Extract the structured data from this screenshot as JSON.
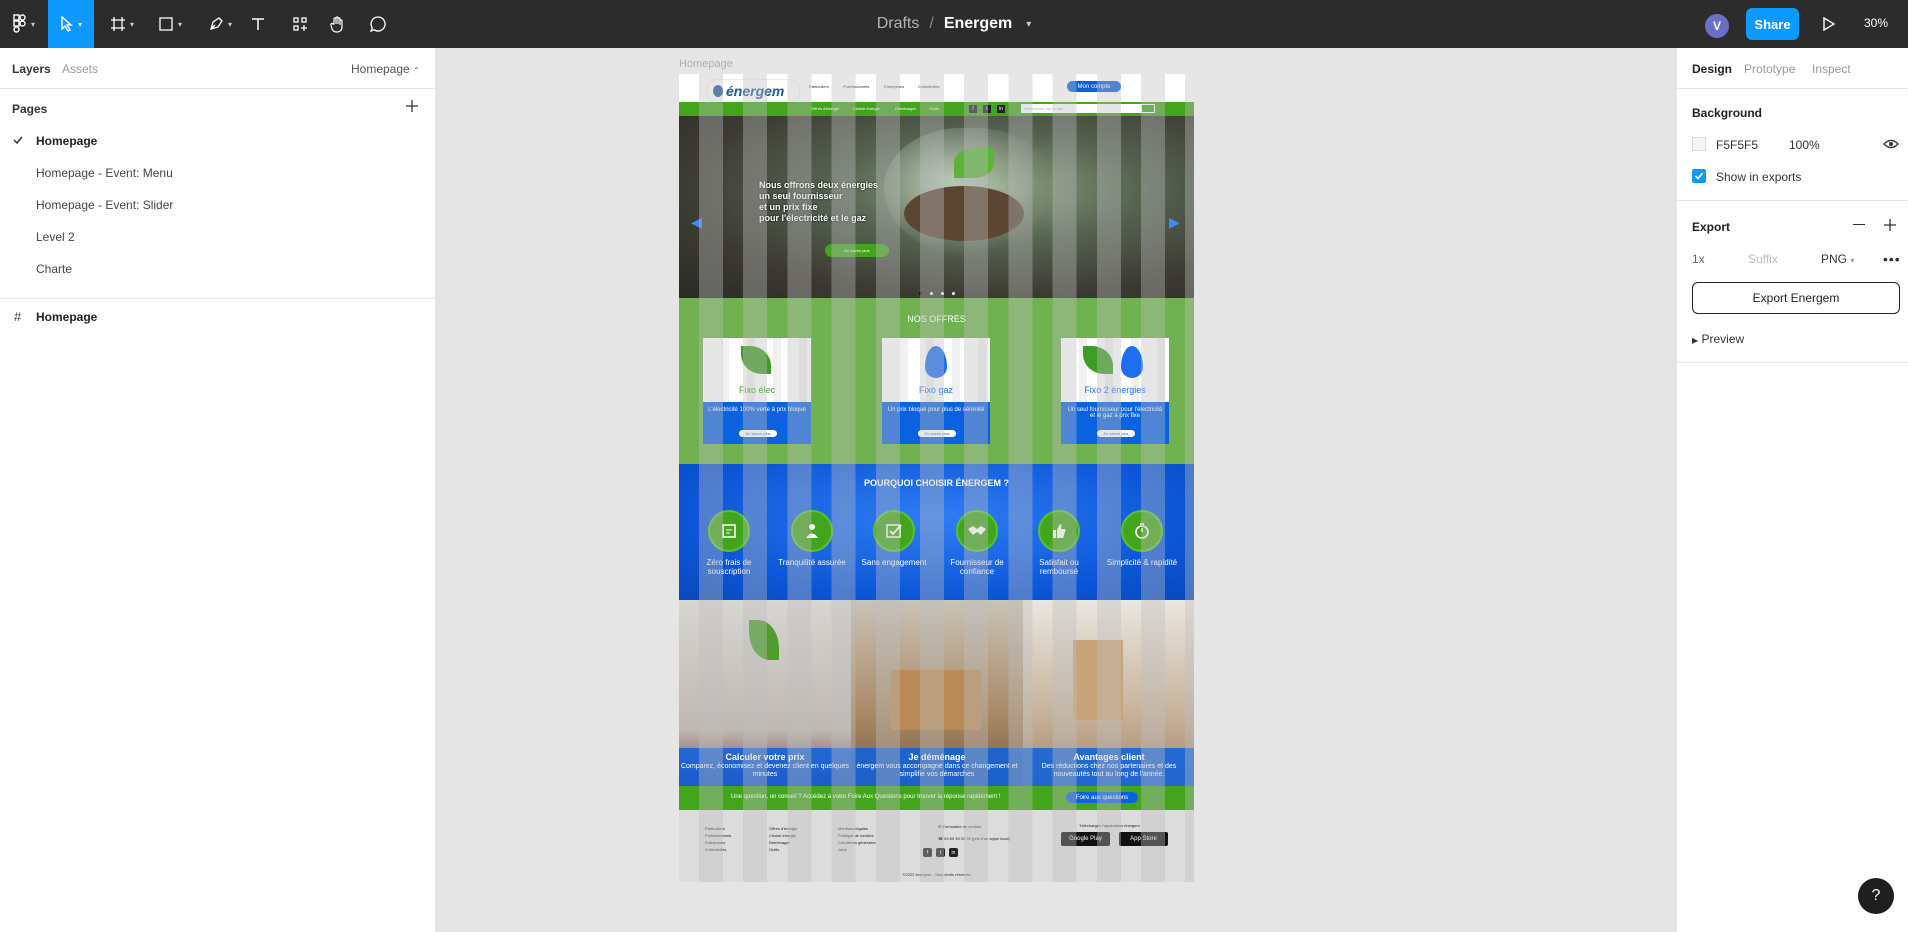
{
  "toolbar": {
    "breadcrumb_parent": "Drafts",
    "breadcrumb_sep": "/",
    "file_name": "Energem",
    "avatar_initial": "V",
    "share_label": "Share",
    "zoom": "30%",
    "accent_color": "#0d99ff"
  },
  "left_panel": {
    "tab_layers": "Layers",
    "tab_assets": "Assets",
    "current_page": "Homepage",
    "pages_title": "Pages",
    "pages": [
      "Homepage",
      "Homepage - Event: Menu",
      "Homepage - Event: Slider",
      "Level 2",
      "Charte"
    ],
    "layer": "Homepage"
  },
  "right_panel": {
    "tab_design": "Design",
    "tab_prototype": "Prototype",
    "tab_inspect": "Inspect",
    "background_title": "Background",
    "background_hex": "F5F5F5",
    "background_opacity": "100%",
    "show_in_exports": "Show in exports",
    "export_title": "Export",
    "export_scale": "1x",
    "export_suffix_placeholder": "Suffix",
    "export_format": "PNG",
    "export_button": "Export Energem",
    "preview": "Preview"
  },
  "canvas": {
    "frame_label": "Homepage",
    "site": {
      "logo": "énergem",
      "logo_tagline": "fournisseur de confiance",
      "nav": [
        "Particuliers",
        "Professionnels",
        "Entreprises",
        "Collectivités"
      ],
      "account_button": "Mon compte",
      "subnav": [
        "Offres d'énergie",
        "Choisir énergie",
        "Déménager",
        "Outils"
      ],
      "social": [
        "f",
        "t",
        "in"
      ],
      "search_placeholder": "Rechercher sur le site",
      "hero_lines": [
        "Nous offrons deux énergies",
        "un seul fournisseur",
        "et un prix fixe",
        "pour l'électricité et le gaz"
      ],
      "hero_cta": "En savoir plus",
      "offers_title": "NOS OFFRES",
      "offers": [
        {
          "name": "Fixo élec",
          "text": "L'électricité 100% verte à prix bloqué",
          "button": "En savoir plus"
        },
        {
          "name": "Fixo gaz",
          "text": "Un prix bloqué pour plus de sérénité",
          "button": "En savoir plus"
        },
        {
          "name": "Fixo 2 énergies",
          "text": "Un seul fournisseur pour l'électricité et le gaz à prix fixe",
          "button": "En savoir plus"
        }
      ],
      "why_title": "POURQUOI CHOISIR ÉNERGEM ?",
      "features": [
        {
          "label": "Zéro frais de souscription",
          "icon": "document-icon"
        },
        {
          "label": "Tranquilité assurée",
          "icon": "person-icon"
        },
        {
          "label": "Sans engagement",
          "icon": "checkbox-icon"
        },
        {
          "label": "Fournisseur de confiance",
          "icon": "handshake-icon"
        },
        {
          "label": "Satisfait ou remboursé",
          "icon": "thumbs-up-icon"
        },
        {
          "label": "Simplicité & rapidité",
          "icon": "stopwatch-icon"
        }
      ],
      "tiles": [
        {
          "title": "Calculer votre prix",
          "text": "Comparez, économisez et devenez client en quelques minutes"
        },
        {
          "title": "Je déménage",
          "text": "énergem vous accompagne dans ce changement et simplifie vos démarches"
        },
        {
          "title": "Avantages client",
          "text": "Des réductions chez nos partenaires et des nouveautés tout au long de l'année."
        }
      ],
      "faq_text": "Une question, un conseil ? Accédez à votre Foire Aux Questions pour trouver la réponse rapidement !",
      "faq_button": "Foire aux questions",
      "footer_cols": [
        [
          "Particuliers",
          "Professionnels",
          "Entreprises",
          "Collectivités"
        ],
        [
          "Offres d'énergie",
          "Choisir énergie",
          "Déménager",
          "Outils"
        ],
        [
          "Mentions légales",
          "Politique de cookies",
          "Conditions générales",
          "Jobs"
        ]
      ],
      "contact_form": "Formulaire de contact",
      "contact_phone": "09 69 39 02 39 (prix d'un appel local)",
      "app_title": "Téléchargez l'application énergem",
      "store_google": "Google Play",
      "store_apple": "App Store",
      "copyright": "©2022 énergem - Tous droits réservés"
    }
  }
}
